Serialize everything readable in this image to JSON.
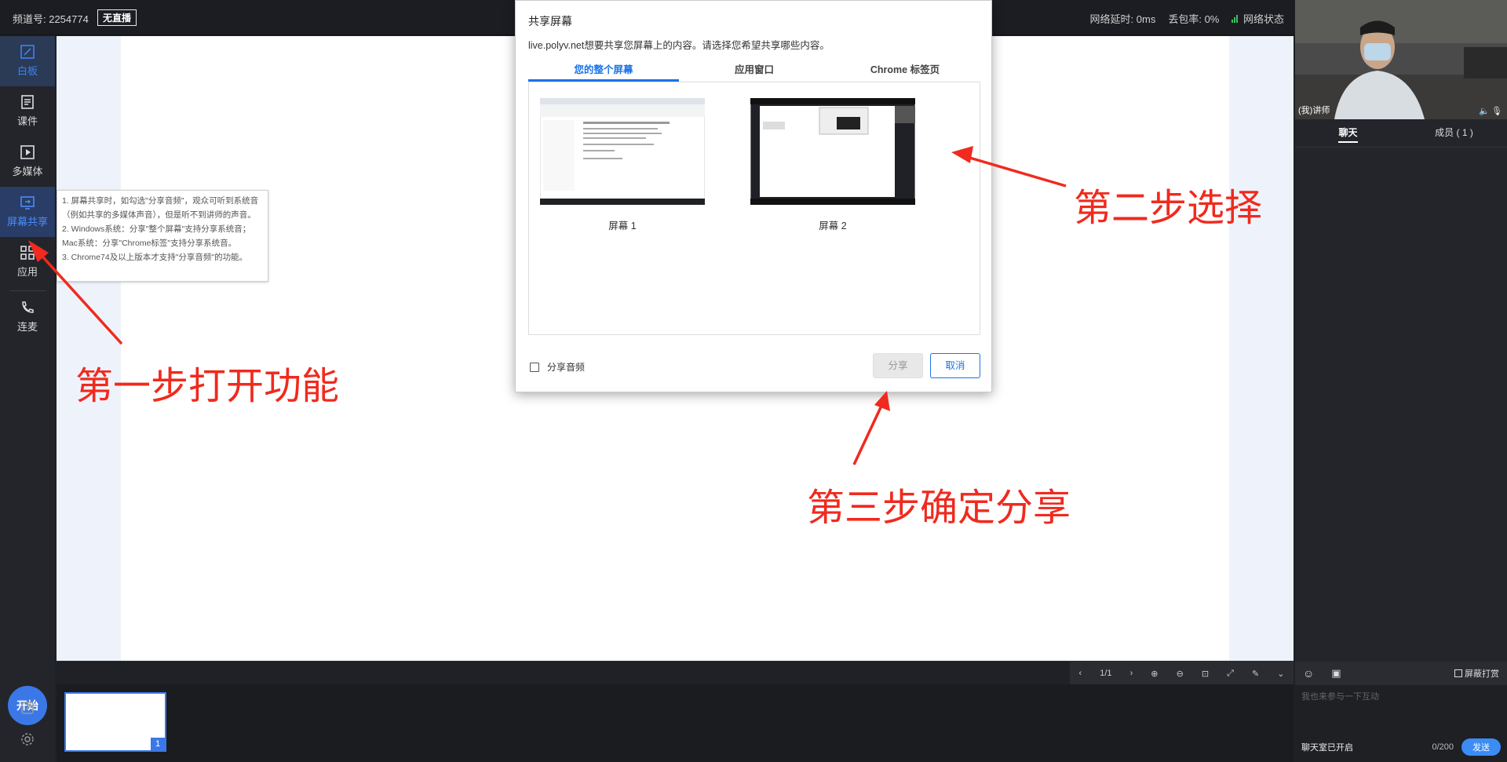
{
  "topbar": {
    "channel": "频道号: 2254774",
    "live_status": "无直播",
    "latency": "网络延时: 0ms",
    "loss": "丢包率: 0%",
    "network": "网络状态",
    "signal_color": "#3fbf5f"
  },
  "nav": {
    "items": [
      {
        "label": "白板",
        "icon": "whiteboard-icon"
      },
      {
        "label": "课件",
        "icon": "courseware-icon"
      },
      {
        "label": "多媒体",
        "icon": "media-play-icon"
      },
      {
        "label": "屏幕共享",
        "icon": "screen-share-icon"
      },
      {
        "label": "应用",
        "icon": "apps-grid-icon"
      },
      {
        "label": "连麦",
        "icon": "phone-icon"
      }
    ],
    "start_label": "开始",
    "accent": "#3b78e7"
  },
  "tooltip": {
    "lines": [
      "1. 屏幕共享时，如勾选\"分享音频\"，观众可听到系统音（例如共享的多媒体声音），但是听不到讲师的声音。",
      "2. Windows系统：分享\"整个屏幕\"支持分享系统音；Mac系统：分享\"Chrome标签\"支持分享系统音。",
      "3. Chrome74及以上版本才支持\"分享音频\"的功能。"
    ]
  },
  "dialog": {
    "title": "共享屏幕",
    "desc": "live.polyv.net想要共享您屏幕上的内容。请选择您希望共享哪些内容。",
    "tabs": [
      "您的整个屏幕",
      "应用窗口",
      "Chrome 标签页"
    ],
    "screens": [
      "屏幕 1",
      "屏幕 2"
    ],
    "audio_label": "分享音频",
    "share_label": "分享",
    "cancel_label": "取消",
    "link_color": "#1a73e8"
  },
  "pager": {
    "page": "1/1"
  },
  "thumb": {
    "page_num": "1"
  },
  "camera": {
    "name": "(我)讲师"
  },
  "chat": {
    "tabs": [
      "聊天",
      "成员 ( 1 )"
    ],
    "block_label": "屏蔽打赏",
    "placeholder": "我也来参与一下互动",
    "status": "聊天室已开启",
    "count": "0/200",
    "send_label": "发送"
  },
  "annotations": {
    "step1": "第一步打开功能",
    "step2": "第二步选择",
    "step3": "第三步确定分享",
    "color": "#f02a1e"
  }
}
